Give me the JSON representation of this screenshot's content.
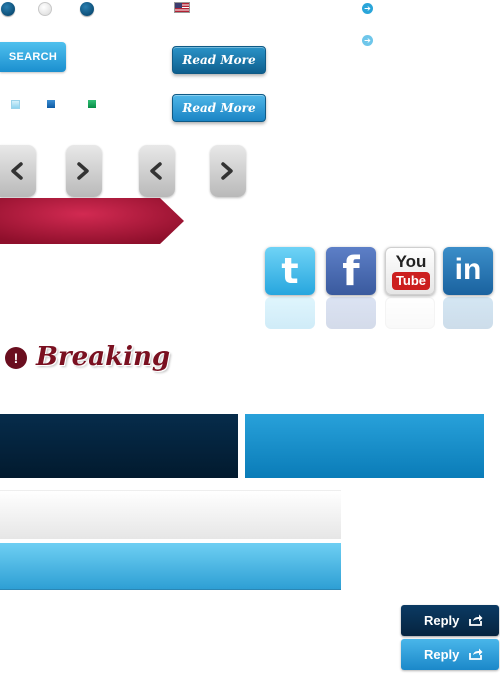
{
  "buttons": {
    "search_label": "SEARCH",
    "read_more_1": "Read More",
    "read_more_2": "Read More",
    "reply_dark": "Reply",
    "reply_blue": "Reply"
  },
  "breaking": {
    "label": "Breaking",
    "icon": "!"
  },
  "social": {
    "twitter": "t",
    "facebook": "f",
    "youtube_top": "You",
    "youtube_bottom": "Tube",
    "linkedin": "in"
  },
  "icons": {
    "arrow": "➔"
  },
  "colors": {
    "accent_blue": "#1b8fcf",
    "dark_navy": "#062c4b",
    "crimson": "#b0173a"
  }
}
